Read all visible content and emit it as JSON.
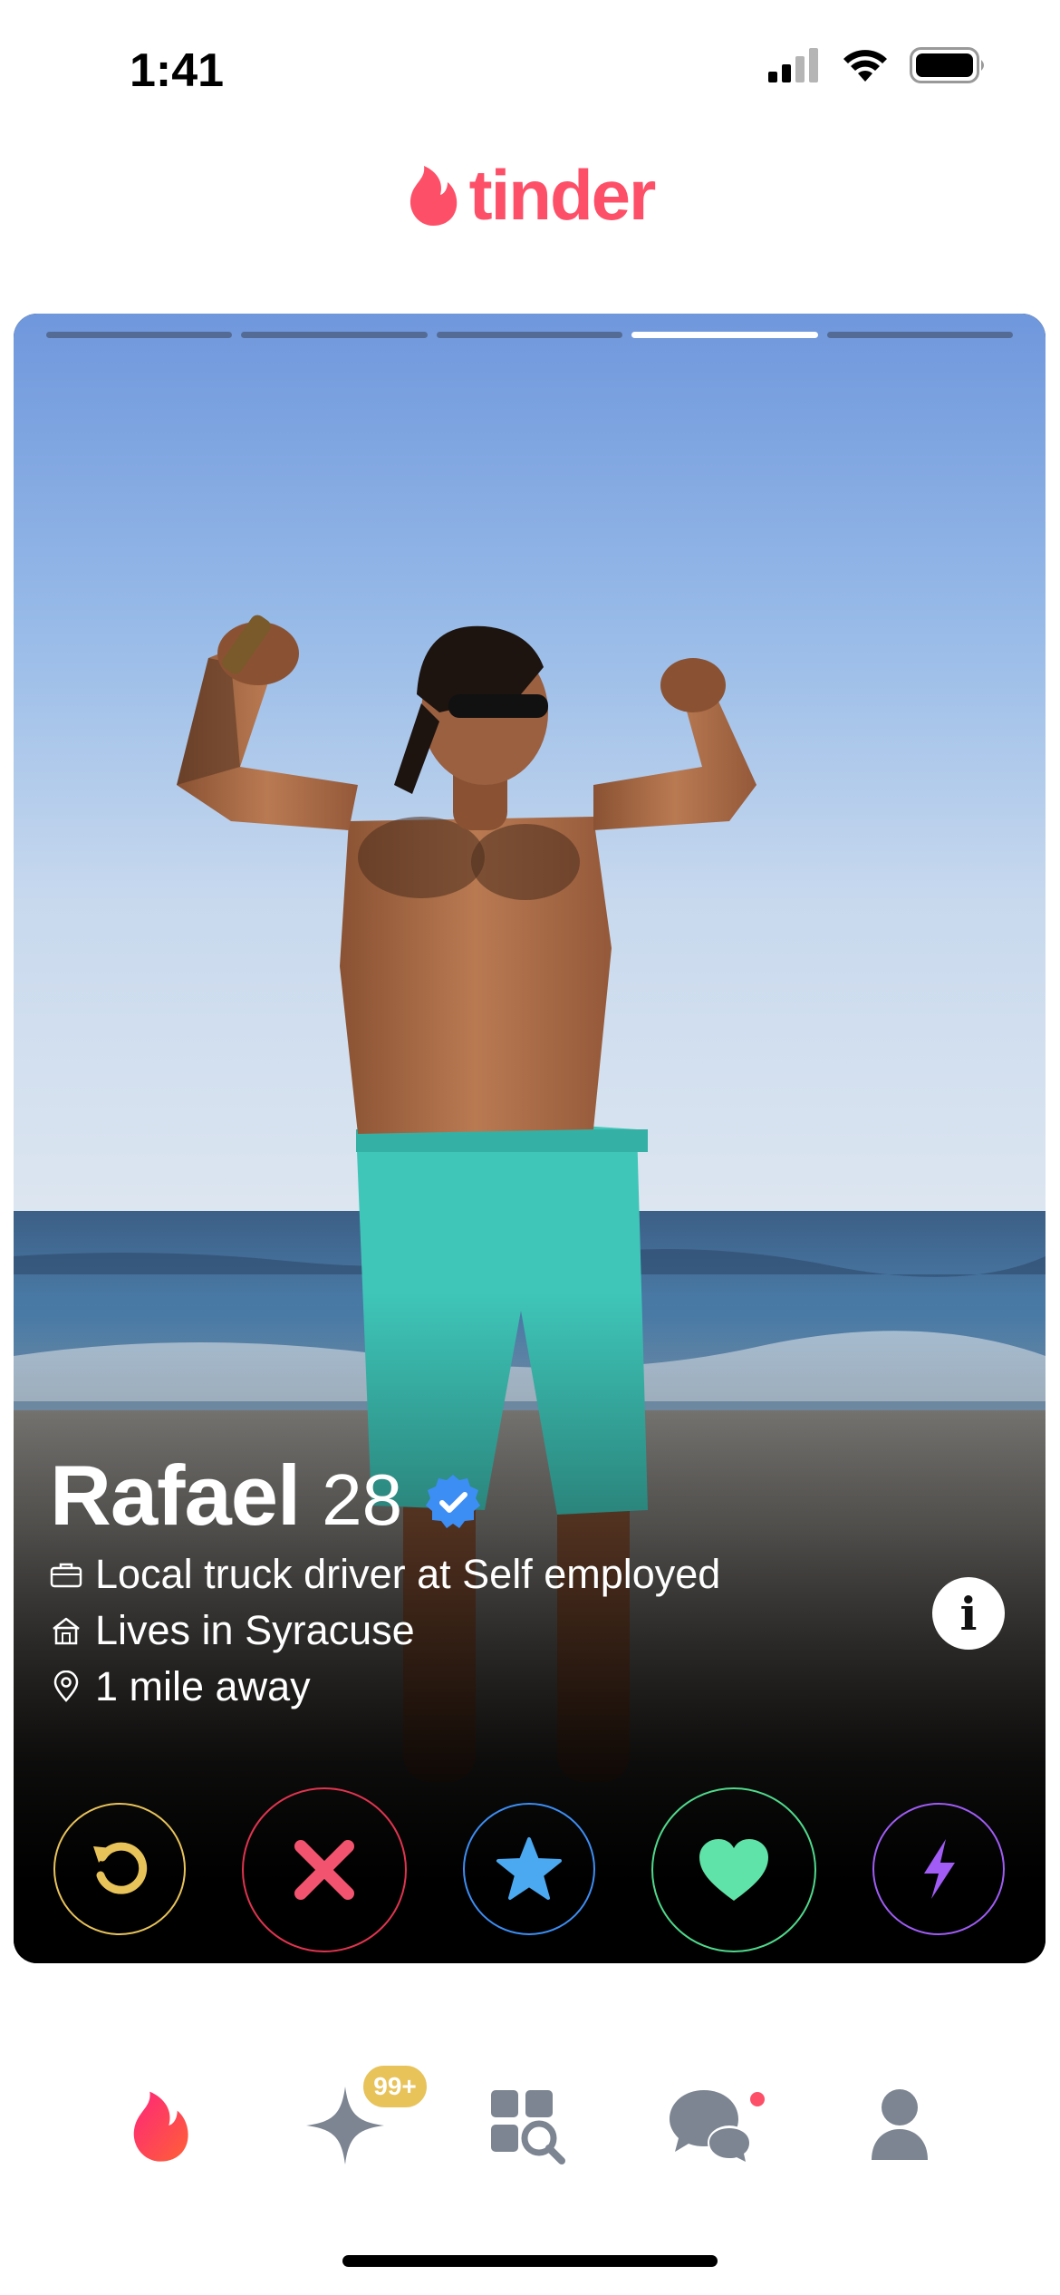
{
  "status_bar": {
    "time": "1:41",
    "icons": [
      "cellular-signal-icon",
      "wifi-icon",
      "battery-icon"
    ]
  },
  "header": {
    "brand": "tinder",
    "brand_icon": "flame-icon",
    "brand_color": "#fd5068"
  },
  "card": {
    "photo_index": 4,
    "photo_count": 5,
    "name": "Rafael",
    "age": "28",
    "verified": true,
    "details": [
      {
        "icon": "briefcase-icon",
        "text": "Local truck driver at Self employed"
      },
      {
        "icon": "home-icon",
        "text": "Lives in Syracuse"
      },
      {
        "icon": "location-pin-icon",
        "text": "1 mile away"
      }
    ],
    "info_button_label": "i"
  },
  "actions": [
    {
      "name": "rewind",
      "icon": "rewind-icon",
      "color": "#e8c35a"
    },
    {
      "name": "nope",
      "icon": "x-icon",
      "color": "#e0344f"
    },
    {
      "name": "super-like",
      "icon": "star-icon",
      "color": "#3d8ef4"
    },
    {
      "name": "like",
      "icon": "heart-icon",
      "color": "#4fd98c"
    },
    {
      "name": "boost",
      "icon": "lightning-icon",
      "color": "#a05cf5"
    }
  ],
  "bottom_nav": {
    "items": [
      {
        "name": "recs",
        "icon": "flame-icon",
        "active": true
      },
      {
        "name": "gold",
        "icon": "sparkle-icon",
        "active": false
      },
      {
        "name": "explore",
        "icon": "explore-grid-icon",
        "active": false
      },
      {
        "name": "chat",
        "icon": "chat-bubbles-icon",
        "active": false
      },
      {
        "name": "profile",
        "icon": "person-icon",
        "active": false
      }
    ],
    "gold_badge": "99+",
    "chat_has_notification": true
  }
}
